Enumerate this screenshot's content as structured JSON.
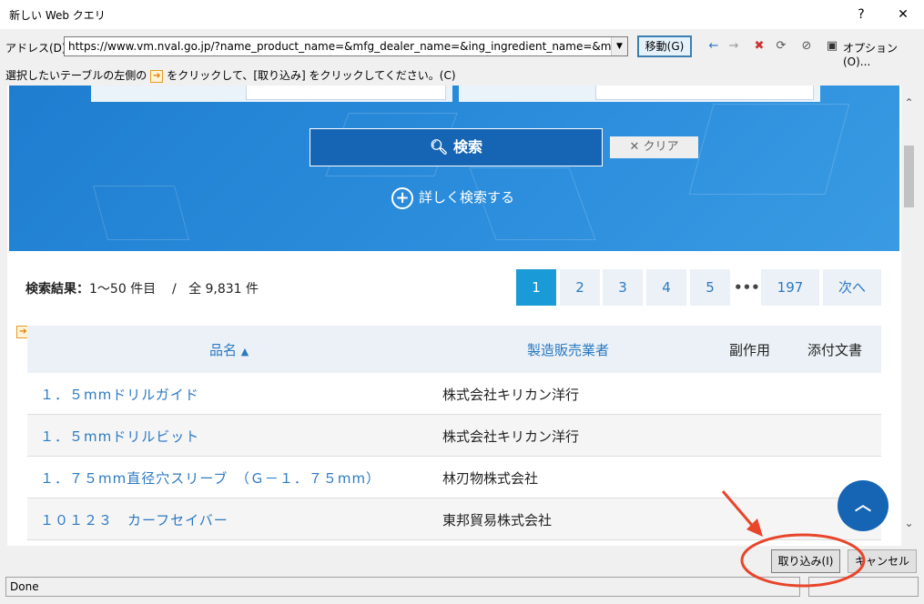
{
  "window": {
    "title": "新しい Web クエリ",
    "help_glyph": "?",
    "close_glyph": "✕"
  },
  "address": {
    "label": "アドレス(D):",
    "url": "https://www.vm.nval.go.jp/?name_product_name=&mfg_dealer_name=&ing_ingredient_name=&med",
    "go_label": "移動(G)",
    "options_label": "オプション(O)..."
  },
  "instruction": {
    "prefix": "選択したいテーブルの左側の",
    "suffix": "をクリックして、[取り込み] をクリックしてください。(C)"
  },
  "search": {
    "search_label": "検索",
    "clear_label": "クリア",
    "advanced_label": "詳しく検索する"
  },
  "results": {
    "label": "検索結果：",
    "range": "1〜50 件目",
    "separator": "/",
    "total": "全 9,831 件"
  },
  "pagination": {
    "pages": [
      "1",
      "2",
      "3",
      "4",
      "5"
    ],
    "active": "1",
    "ellipsis": "•••",
    "last": "197",
    "next": "次へ"
  },
  "table": {
    "headers": {
      "name": "品名",
      "sort_indicator": "▲",
      "maker": "製造販売業者",
      "side_effects": "副作用",
      "documents": "添付文書"
    },
    "rows": [
      {
        "name": "１．５mmドリルガイド",
        "maker": "株式会社キリカン洋行"
      },
      {
        "name": "１．５mmドリルビット",
        "maker": "株式会社キリカン洋行"
      },
      {
        "name": "１．７５mm直径穴スリーブ　（Ｇ－１．７５mm）",
        "maker": "林刃物株式会社"
      },
      {
        "name": "１０１２３　カーフセイバー",
        "maker": "東邦貿易株式会社"
      }
    ]
  },
  "buttons": {
    "import": "取り込み(I)",
    "cancel": "キャンセル"
  },
  "status": {
    "text": "Done"
  },
  "colors": {
    "accent": "#1665b4",
    "link": "#2b79c2",
    "annotation": "#e8452a"
  }
}
